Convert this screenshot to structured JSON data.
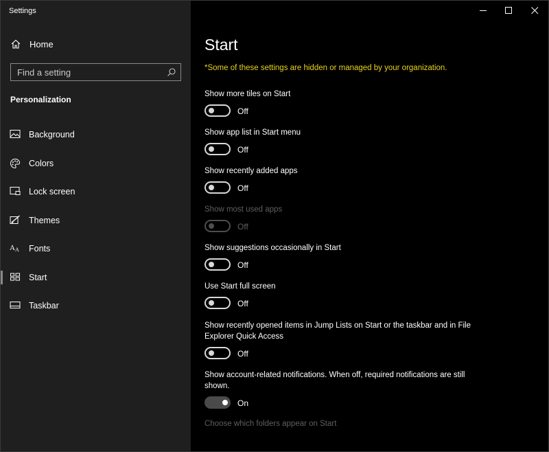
{
  "window": {
    "title": "Settings"
  },
  "sidebar": {
    "home_label": "Home",
    "search_placeholder": "Find a setting",
    "section_title": "Personalization",
    "items": [
      {
        "label": "Background",
        "icon": "picture-icon"
      },
      {
        "label": "Colors",
        "icon": "palette-icon"
      },
      {
        "label": "Lock screen",
        "icon": "lock-screen-icon"
      },
      {
        "label": "Themes",
        "icon": "themes-icon"
      },
      {
        "label": "Fonts",
        "icon": "fonts-icon"
      },
      {
        "label": "Start",
        "icon": "start-icon",
        "active": true
      },
      {
        "label": "Taskbar",
        "icon": "taskbar-icon"
      }
    ]
  },
  "main": {
    "title": "Start",
    "notice": "*Some of these settings are hidden or managed by your organization.",
    "settings": [
      {
        "label": "Show more tiles on Start",
        "state": "Off",
        "enabled": true
      },
      {
        "label": "Show app list in Start menu",
        "state": "Off",
        "enabled": true
      },
      {
        "label": "Show recently added apps",
        "state": "Off",
        "enabled": true
      },
      {
        "label": "Show most used apps",
        "state": "Off",
        "enabled": false
      },
      {
        "label": "Show suggestions occasionally in Start",
        "state": "Off",
        "enabled": true
      },
      {
        "label": "Use Start full screen",
        "state": "Off",
        "enabled": true
      },
      {
        "label": "Show recently opened items in Jump Lists on Start or the taskbar and in File Explorer Quick Access",
        "state": "Off",
        "enabled": true
      },
      {
        "label": "Show account-related notifications. When off, required notifications are still shown.",
        "state": "On",
        "enabled": true
      }
    ],
    "folders_link": "Choose which folders appear on Start"
  },
  "colors": {
    "notice": "#e8d21d",
    "sidebar_bg": "#1f1f1f",
    "main_bg": "#000000",
    "disabled_text": "#5f5f5f"
  }
}
